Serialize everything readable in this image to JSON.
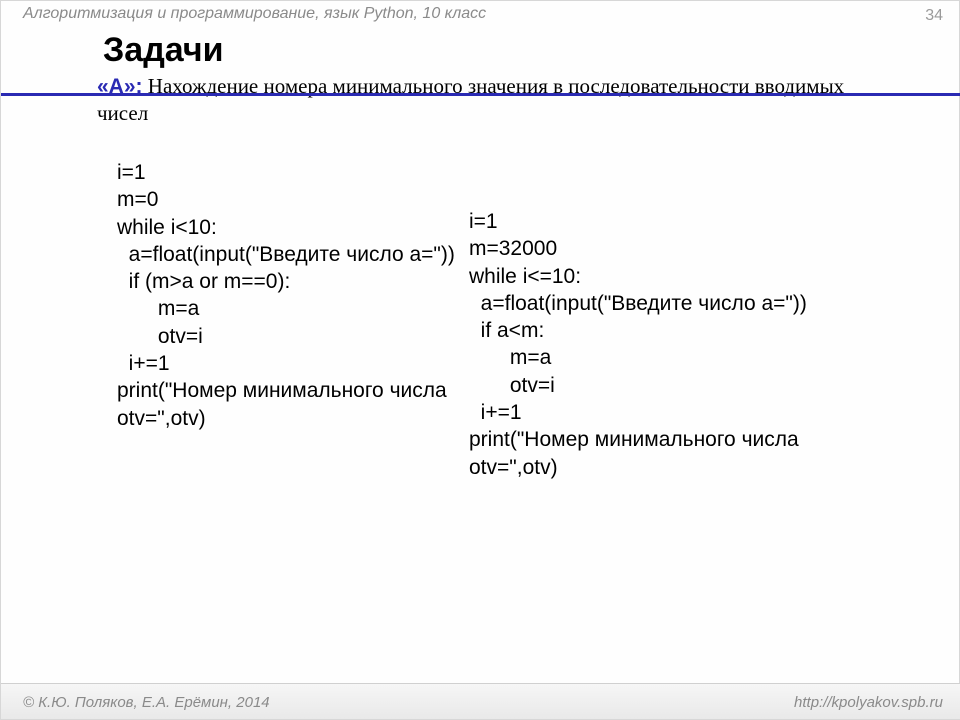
{
  "header": "Алгоритмизация и программирование, язык Python, 10 класс",
  "page_number": "34",
  "title": "Задачи",
  "task_label": "«A»:",
  "task_text": " Нахождение номера минимального значения в последовательности вводимых чисел",
  "code_left": "i=1\nm=0\nwhile i<10:\n  a=float(input(\"Введите число a=\"))\n  if (m>a or m==0):\n       m=a\n       otv=i\n  i+=1\nprint(\"Номер минимального числа\notv=\",otv)",
  "code_right": "i=1\nm=32000\nwhile i<=10:\n  a=float(input(\"Введите число a=\"))\n  if a<m:\n       m=a\n       otv=i\n  i+=1\nprint(\"Номер минимального числа\notv=\",otv)",
  "footer_left": "© К.Ю. Поляков, Е.А. Ерёмин, 2014",
  "footer_right": "http://kpolyakov.spb.ru"
}
